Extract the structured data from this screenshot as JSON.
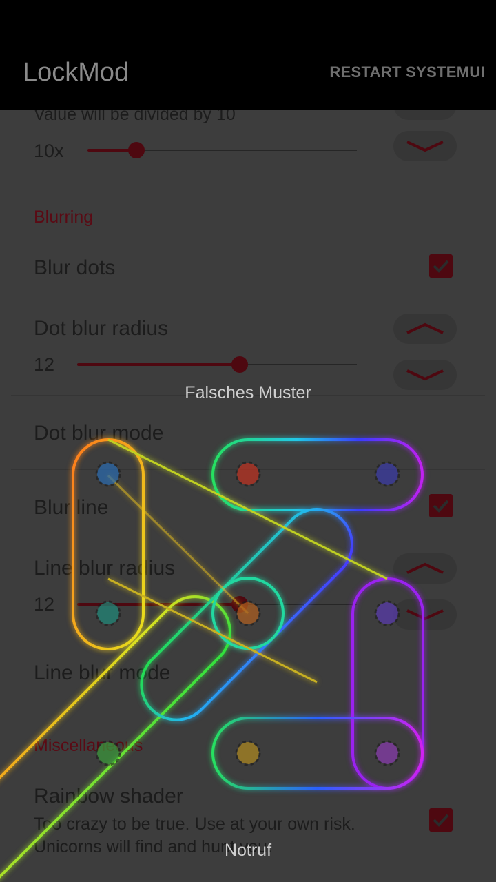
{
  "appbar": {
    "title": "LockMod",
    "action_label": "RESTART SYSTEMUI"
  },
  "settings": {
    "divide_hint": "Value will be divided by 10",
    "multiplier_value": "10x",
    "multiplier_level": 0.18,
    "blurring_header": "Blurring",
    "blur_dots_label": "Blur dots",
    "blur_dots_checked": true,
    "dot_blur_radius_label": "Dot blur radius",
    "dot_blur_radius_value": "12",
    "dot_blur_radius_level": 0.58,
    "dot_blur_mode_label": "Dot blur mode",
    "blur_line_label": "Blur line",
    "blur_line_checked": true,
    "line_blur_radius_label": "Line blur radius",
    "line_blur_radius_value": "12",
    "line_blur_radius_level": 0.58,
    "line_blur_mode_label": "Line blur mode",
    "misc_header": "Miscellaneous",
    "rainbow_label": "Rainbow shader",
    "rainbow_desc_line1": "Too crazy to be true. Use at your own risk.",
    "rainbow_desc_line2": "Unicorns will find and hunt you.",
    "rainbow_checked": true
  },
  "lockscreen": {
    "status_message": "Falsches Muster",
    "emergency_label": "Notruf"
  },
  "colors": {
    "accent": "#4e0810",
    "appbar_bg": "#000000"
  },
  "icons": {
    "step_up": "chevron-up-icon",
    "step_down": "chevron-down-icon",
    "check": "check-icon"
  }
}
